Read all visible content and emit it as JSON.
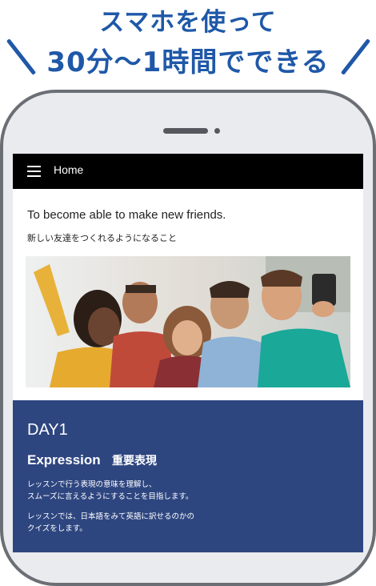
{
  "headline": {
    "line1": "スマホを使って",
    "line2": "30分〜1時間でできる"
  },
  "app": {
    "nav_title": "Home",
    "lesson_title_en": "To become able to make new friends.",
    "lesson_title_ja": "新しい友達をつくれるようになること",
    "photo_icon": "group-selfie-photo"
  },
  "panel": {
    "day": "DAY1",
    "expression_label": "Expression",
    "expression_ja": "重要表現",
    "desc1_line1": "レッスンで行う表現の意味を理解し、",
    "desc1_line2": "スムーズに言えるようにすることを目指します。",
    "desc2_line1": "レッスンでは、日本語をみて英語に訳せるのかの",
    "desc2_line2": "クイズをします。"
  },
  "colors": {
    "headline_blue": "#1f58a8",
    "panel_navy": "#2e4680",
    "topbar": "#000000"
  }
}
